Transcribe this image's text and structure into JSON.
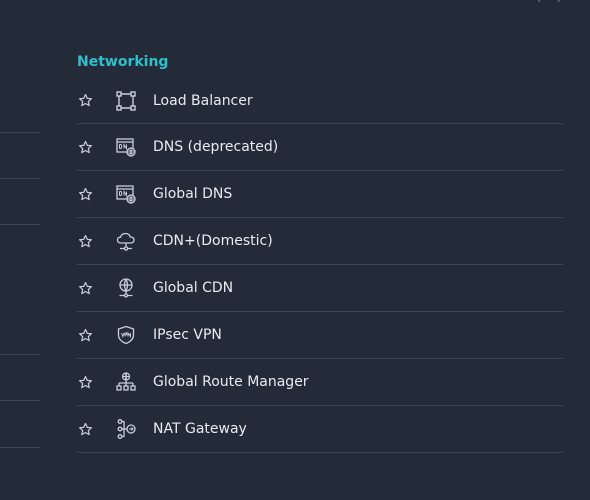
{
  "section": {
    "title": "Networking",
    "accent_color": "#2ec1cc",
    "items": [
      {
        "label": "Load Balancer",
        "icon": "load-balancer-icon",
        "favorite": false
      },
      {
        "label": "DNS (deprecated)",
        "icon": "dns-icon",
        "favorite": false
      },
      {
        "label": "Global DNS",
        "icon": "global-dns-icon",
        "favorite": false
      },
      {
        "label": "CDN+(Domestic)",
        "icon": "cloud-cdn-icon",
        "favorite": false
      },
      {
        "label": "Global CDN",
        "icon": "global-cdn-icon",
        "favorite": false
      },
      {
        "label": "IPsec VPN",
        "icon": "vpn-shield-icon",
        "favorite": false
      },
      {
        "label": "Global Route Manager",
        "icon": "route-manager-icon",
        "favorite": false
      },
      {
        "label": "NAT Gateway",
        "icon": "nat-gateway-icon",
        "favorite": false
      }
    ]
  }
}
